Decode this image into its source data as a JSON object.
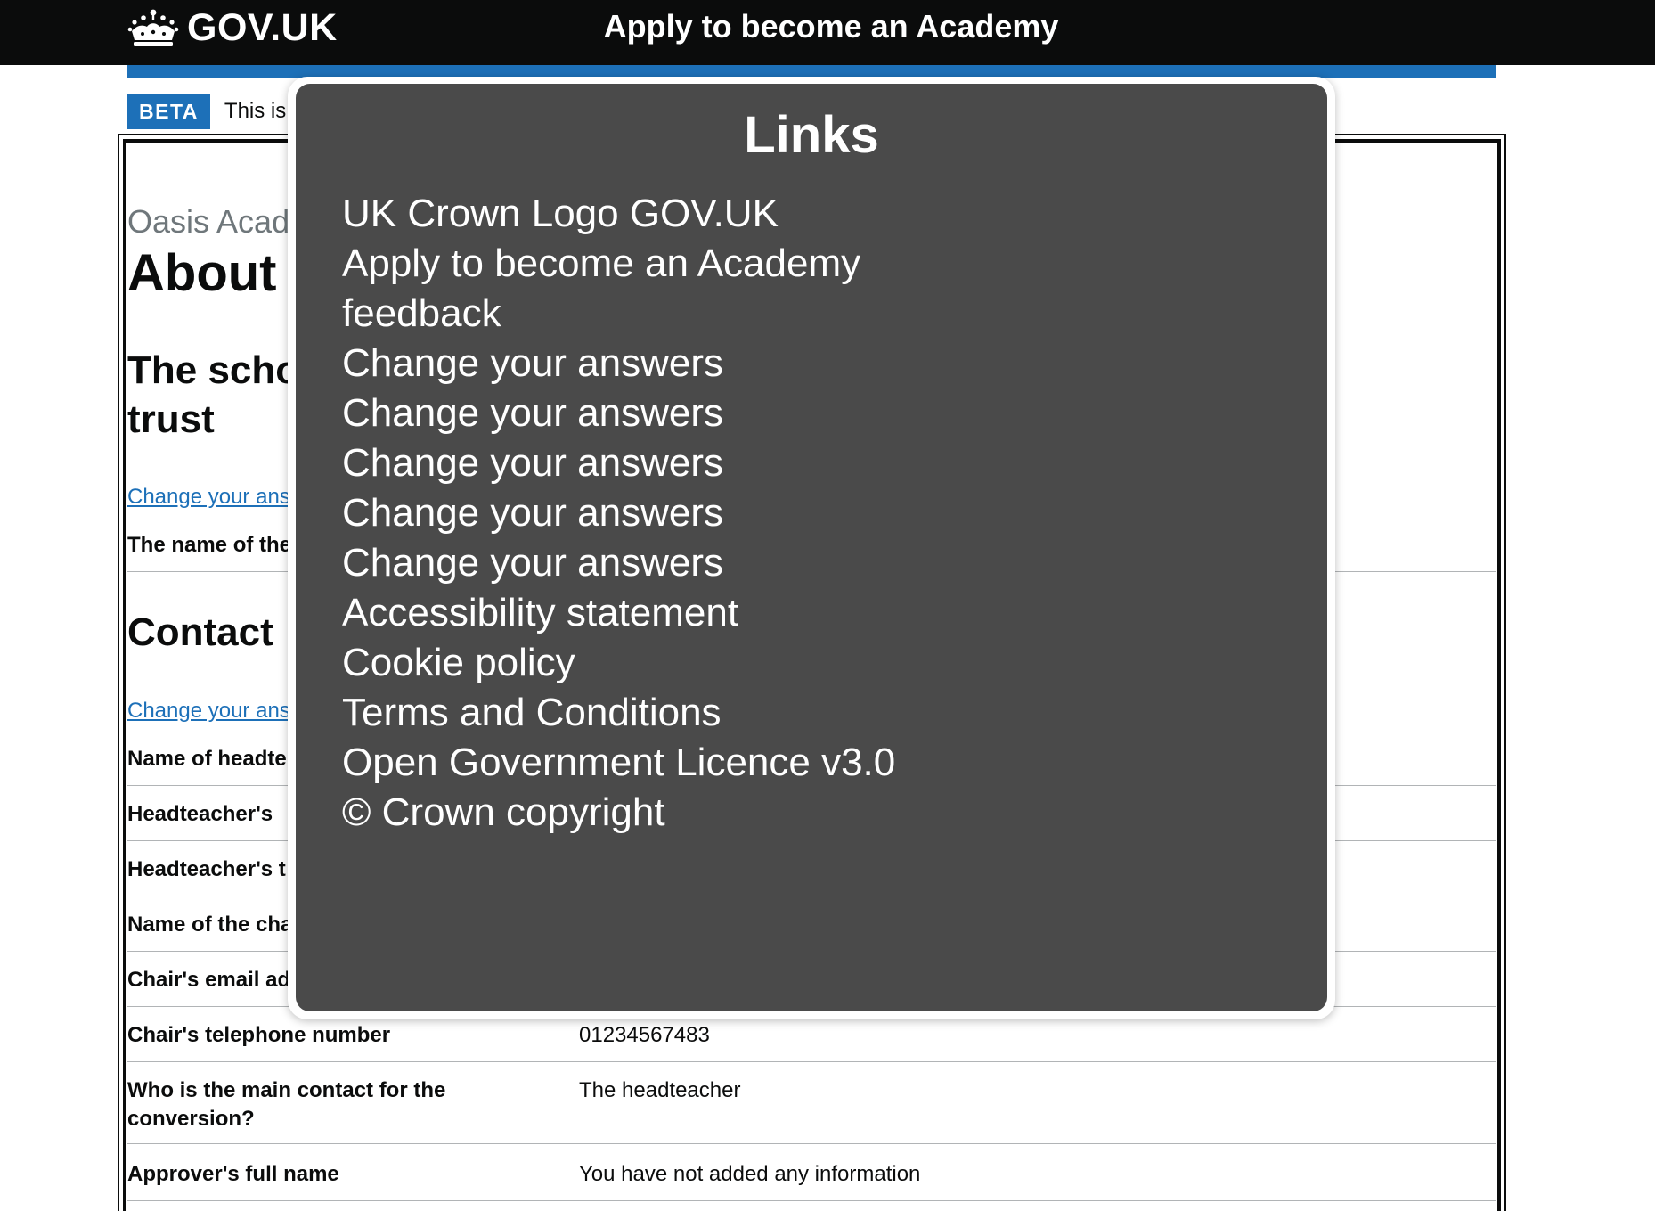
{
  "header": {
    "logo_text": "GOV.UK",
    "service_name": "Apply to become an Academy"
  },
  "phase_banner": {
    "tag": "BETA",
    "text_visible": "This is"
  },
  "page": {
    "caption_visible": "Oasis Acad",
    "title_visible": "About t",
    "sections": [
      {
        "heading_visible": "The scho\ntrust",
        "change_link_visible": "Change your ans",
        "rows": [
          {
            "key": "The name of the",
            "value": ""
          }
        ]
      },
      {
        "heading_visible": "Contact",
        "change_link_visible": "Change your ans",
        "rows": [
          {
            "key": "Name of headte",
            "value": ""
          },
          {
            "key": "Headteacher's",
            "value": ""
          },
          {
            "key": "Headteacher's t",
            "value": ""
          },
          {
            "key": "Name of the cha",
            "value": ""
          },
          {
            "key": "Chair's email ad",
            "value": ""
          },
          {
            "key": "Chair's telephone number",
            "value": "01234567483"
          },
          {
            "key": "Who is the main contact for the conversion?",
            "value": "The headteacher"
          },
          {
            "key": "Approver's full name",
            "value": "You have not added any information"
          }
        ]
      }
    ]
  },
  "overlay": {
    "title": "Links",
    "links": [
      "UK Crown Logo GOV.UK",
      "Apply to become an Academy",
      "feedback",
      "Change your answers",
      "Change your answers",
      "Change your answers",
      "Change your answers",
      "Change your answers",
      "Accessibility statement",
      "Cookie policy",
      "Terms and Conditions",
      "Open Government Licence v3.0",
      "© Crown copyright"
    ]
  },
  "colors": {
    "header_bg": "#0b0c0c",
    "brand_blue": "#1d70b8",
    "overlay_bg": "#4a4a4a",
    "caption_grey": "#6f777b"
  },
  "icons": [
    "crown-icon"
  ]
}
